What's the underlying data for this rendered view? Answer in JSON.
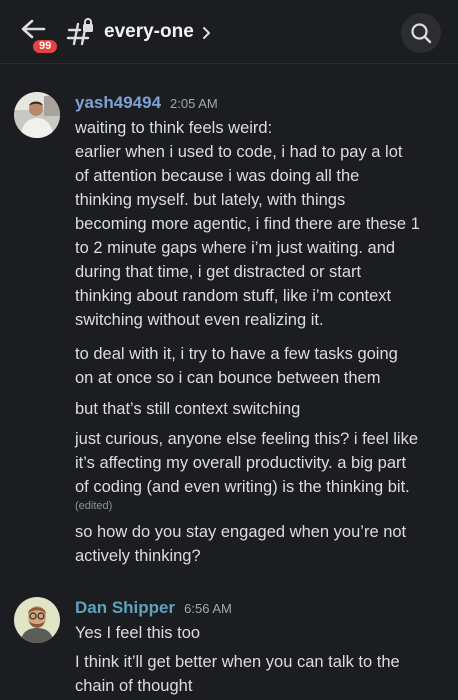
{
  "header": {
    "channel_name": "every-one",
    "badge_count": "99",
    "icons": {
      "back": "arrow-left-icon",
      "channel": "locked-hash-icon",
      "chevron": "chevron-right-icon",
      "search": "search-icon"
    }
  },
  "colors": {
    "background": "#1c1d21",
    "badge": "#e5433f",
    "author_yash": "#7ea1d6",
    "author_dan": "#5fa3bb"
  },
  "messages": [
    {
      "author": "yash49494",
      "time": "2:05 AM",
      "paragraphs": [
        {
          "lines": [
            "waiting to think feels weird:",
            "earlier when i used to code, i had to pay a lot",
            "of attention because i was doing all the",
            "thinking myself. but lately, with things",
            "becoming more agentic, i find there are these 1",
            "to 2 minute gaps where i’m just waiting. and",
            "during that time, i get distracted or start",
            "thinking about random stuff, like i’m context",
            "switching without even realizing it."
          ]
        },
        {
          "lines": [
            "to deal with it, i try to have a few tasks going",
            "on at once so i can bounce between them"
          ]
        },
        {
          "lines": [
            "but that’s still context switching"
          ]
        },
        {
          "lines": [
            "just curious, anyone else feeling this? i feel like",
            "it’s affecting my overall productivity. a big part",
            "of coding (and even writing) is the thinking bit."
          ],
          "edited": "(edited)"
        },
        {
          "lines": [
            "so how do you stay engaged when you’re not",
            "actively thinking?"
          ]
        }
      ]
    },
    {
      "author": "Dan Shipper",
      "time": "6:56 AM",
      "paragraphs": [
        {
          "lines": [
            "Yes I feel this too"
          ]
        },
        {
          "lines": [
            "I think it’ll get better when you can talk to the",
            "chain of thought"
          ]
        }
      ]
    }
  ]
}
